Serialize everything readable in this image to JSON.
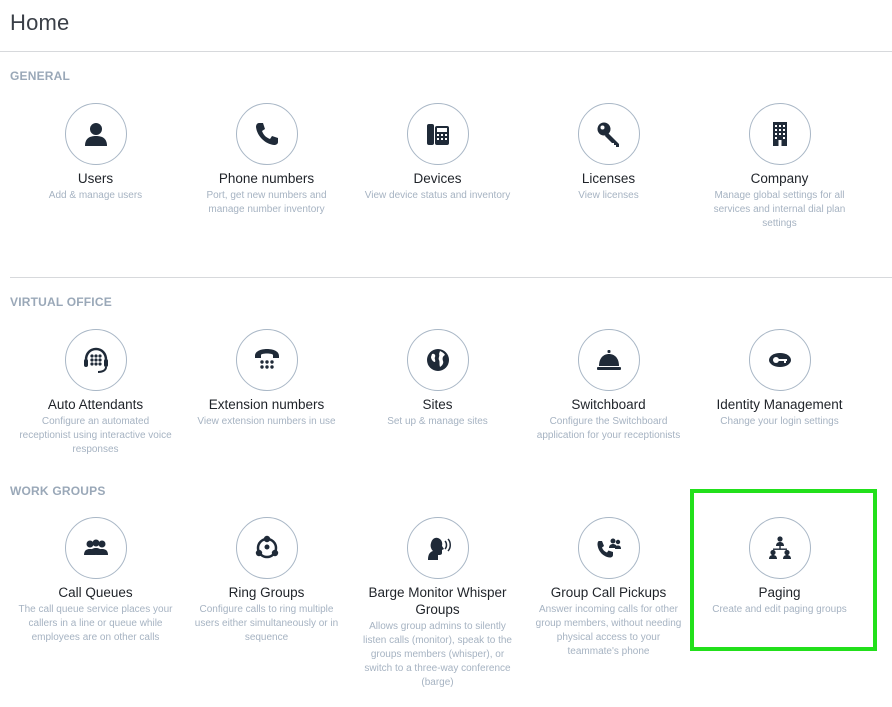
{
  "page": {
    "title": "Home"
  },
  "highlight_color": "#22e01b",
  "sections": [
    {
      "title": "GENERAL",
      "tiles": [
        {
          "icon": "user-icon",
          "title": "Users",
          "desc": "Add & manage users"
        },
        {
          "icon": "phone-icon",
          "title": "Phone numbers",
          "desc": "Port, get new numbers and manage number inventory"
        },
        {
          "icon": "desk-phone-icon",
          "title": "Devices",
          "desc": "View device status and inventory"
        },
        {
          "icon": "key-icon",
          "title": "Licenses",
          "desc": "View licenses"
        },
        {
          "icon": "building-icon",
          "title": "Company",
          "desc": "Manage global settings for all services and internal dial plan settings"
        }
      ]
    },
    {
      "title": "VIRTUAL OFFICE",
      "tiles": [
        {
          "icon": "headset-dialpad-icon",
          "title": "Auto Attendants",
          "desc": "Configure an automated receptionist using interactive voice responses"
        },
        {
          "icon": "rotary-phone-icon",
          "title": "Extension numbers",
          "desc": "View extension numbers in use"
        },
        {
          "icon": "globe-icon",
          "title": "Sites",
          "desc": "Set up & manage sites"
        },
        {
          "icon": "service-bell-icon",
          "title": "Switchboard",
          "desc": "Configure the Switchboard application for your receptionists"
        },
        {
          "icon": "identity-key-icon",
          "title": "Identity Management",
          "desc": "Change your login settings"
        }
      ]
    },
    {
      "title": "WORK GROUPS",
      "tiles": [
        {
          "icon": "group-icon",
          "title": "Call Queues",
          "desc": "The call queue service places your callers in a line or queue while employees are on other calls"
        },
        {
          "icon": "ring-group-icon",
          "title": "Ring Groups",
          "desc": "Configure calls to ring multiple users either simultaneously or in sequence"
        },
        {
          "icon": "speaking-head-icon",
          "title": "Barge Monitor Whisper Groups",
          "desc": "Allows group admins to silently listen calls (monitor), speak to the groups members (whisper), or switch to a three-way conference (barge)"
        },
        {
          "icon": "phone-group-icon",
          "title": "Group Call Pickups",
          "desc": "Answer incoming calls for other group members, without needing physical access to your teammate's phone"
        },
        {
          "icon": "paging-hierarchy-icon",
          "title": "Paging",
          "desc": "Create and edit paging groups"
        }
      ]
    }
  ]
}
